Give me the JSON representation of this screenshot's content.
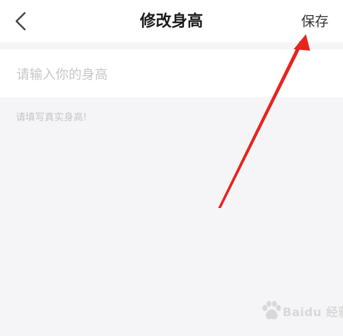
{
  "header": {
    "title": "修改身高",
    "save_label": "保存",
    "back_icon": "chevron-left-icon"
  },
  "form": {
    "height_placeholder": "请输入你的身高",
    "height_value": "",
    "hint": "请填写真实身高!"
  },
  "annotation": {
    "arrow_color": "#e8231c"
  },
  "watermark": {
    "text": "Baidu 经验"
  }
}
